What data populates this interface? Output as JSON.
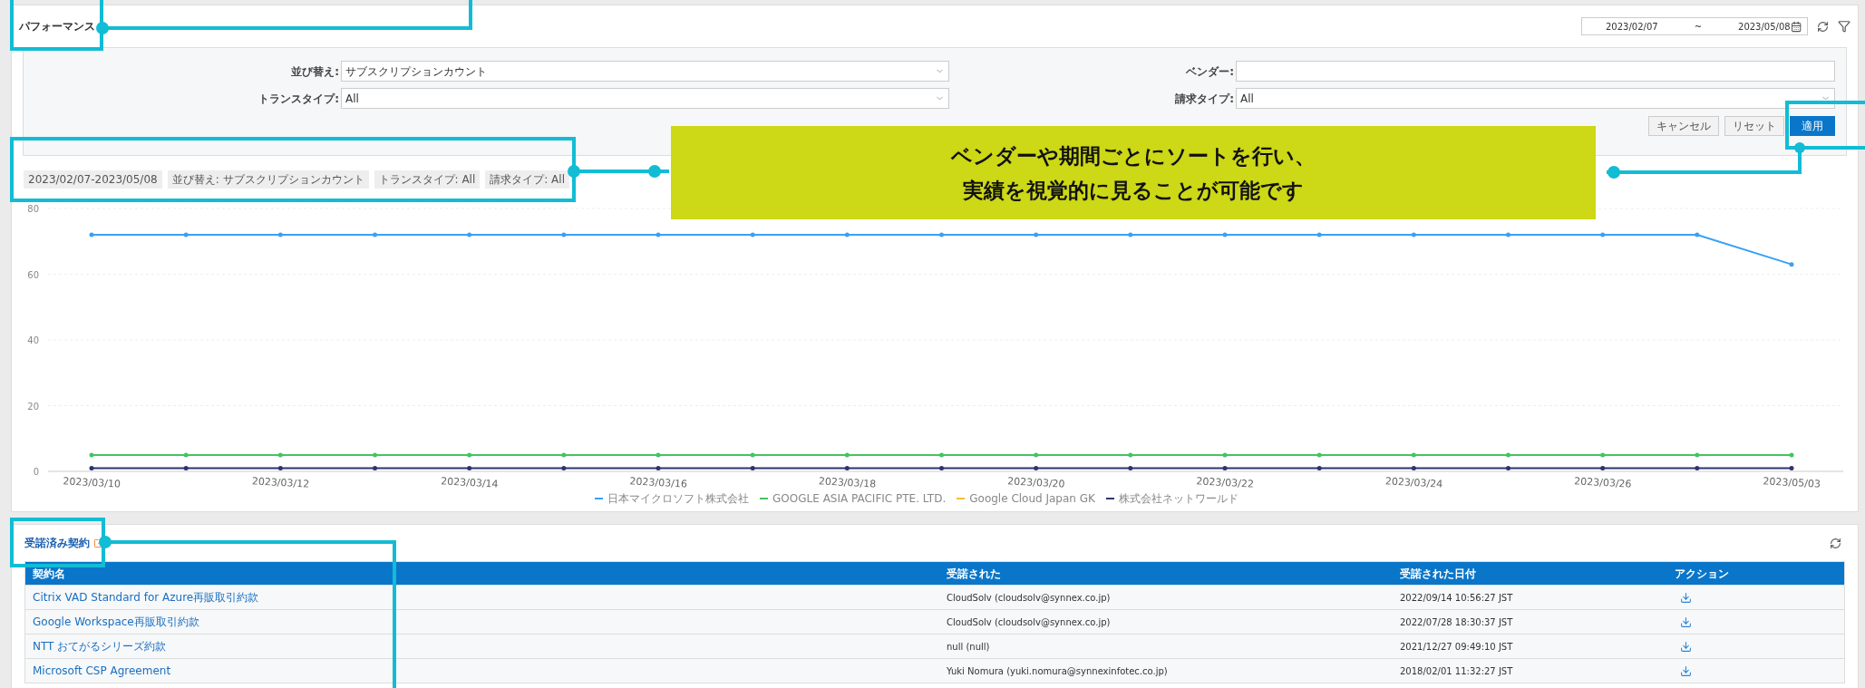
{
  "performance": {
    "title": "パフォーマンス",
    "date_from": "2023/02/07",
    "date_separator": "~",
    "date_to": "2023/05/08",
    "filters": [
      {
        "label": "並び替え:",
        "kind": "select",
        "value": "サブスクリプションカウント"
      },
      {
        "label": "ベンダー:",
        "kind": "text"
      },
      {
        "label": "トランスタイプ:",
        "kind": "select",
        "value": "All"
      },
      {
        "label": "請求タイプ:",
        "kind": "select",
        "value": "All"
      }
    ],
    "buttons": [
      {
        "label": "キャンセル",
        "primary": false
      },
      {
        "label": "リセット",
        "primary": false
      },
      {
        "label": "適用",
        "primary": true
      }
    ],
    "chips": [
      "2023/02/07-2023/05/08",
      "並び替え: サブスクリプションカウント",
      "トランスタイプ: All",
      "請求タイプ: All"
    ],
    "chart_data": {
      "type": "line",
      "categories": [
        "2023/03/10",
        null,
        "2023/03/12",
        null,
        "2023/03/14",
        null,
        "2023/03/16",
        null,
        "2023/03/18",
        null,
        "2023/03/20",
        null,
        "2023/03/22",
        null,
        "2023/03/24",
        null,
        "2023/03/26",
        null,
        "2023/05/03"
      ],
      "grid": true,
      "ylim": [
        0,
        80
      ],
      "yticks": [
        0,
        20,
        40,
        60,
        80
      ],
      "series": [
        {
          "name": "日本マイクロソフト株式会社",
          "color": "#3aa0f5",
          "values": [
            72,
            72,
            72,
            72,
            72,
            72,
            72,
            72,
            72,
            72,
            72,
            72,
            72,
            72,
            72,
            72,
            72,
            72,
            63
          ]
        },
        {
          "name": "GOOGLE ASIA PACIFIC PTE. LTD.",
          "color": "#43c463",
          "values": [
            5,
            5,
            5,
            5,
            5,
            5,
            5,
            5,
            5,
            5,
            5,
            5,
            5,
            5,
            5,
            5,
            5,
            5,
            5
          ]
        },
        {
          "name": "Google Cloud Japan GK",
          "color": "#f5c02c",
          "values": [
            null,
            null,
            null,
            null,
            null,
            null,
            null,
            null,
            null,
            null,
            null,
            null,
            null,
            null,
            null,
            null,
            null,
            null,
            null
          ]
        },
        {
          "name": "株式会社ネットワールド",
          "color": "#2d3370",
          "values": [
            1,
            1,
            1,
            1,
            1,
            1,
            1,
            1,
            1,
            1,
            1,
            1,
            1,
            1,
            1,
            1,
            1,
            1,
            1
          ]
        }
      ]
    }
  },
  "accepted_contracts": {
    "title": "受諾済み契約",
    "columns": [
      "契約名",
      "受諾された",
      "受諾された日付",
      "アクション"
    ],
    "rows": [
      {
        "name": "Citrix VAD Standard for Azure再販取引約款",
        "accepted_by": "CloudSolv (cloudsolv@synnex.co.jp)",
        "date": "2022/09/14 10:56:27 JST"
      },
      {
        "name": "Google Workspace再販取引約款",
        "accepted_by": "CloudSolv (cloudsolv@synnex.co.jp)",
        "date": "2022/07/28 18:30:37 JST"
      },
      {
        "name": "NTT おてがるシリーズ約款",
        "accepted_by": "null (null)",
        "date": "2021/12/27 09:49:10 JST"
      },
      {
        "name": "Microsoft CSP Agreement",
        "accepted_by": "Yuki Nomura (yuki.nomura@synnexinfotec.co.jp)",
        "date": "2018/02/01 11:32:27 JST"
      }
    ]
  },
  "callout": {
    "lines": [
      "ベンダーや期間ごとにソートを行い、",
      "実績を視覚的に見ることが可能です"
    ]
  }
}
